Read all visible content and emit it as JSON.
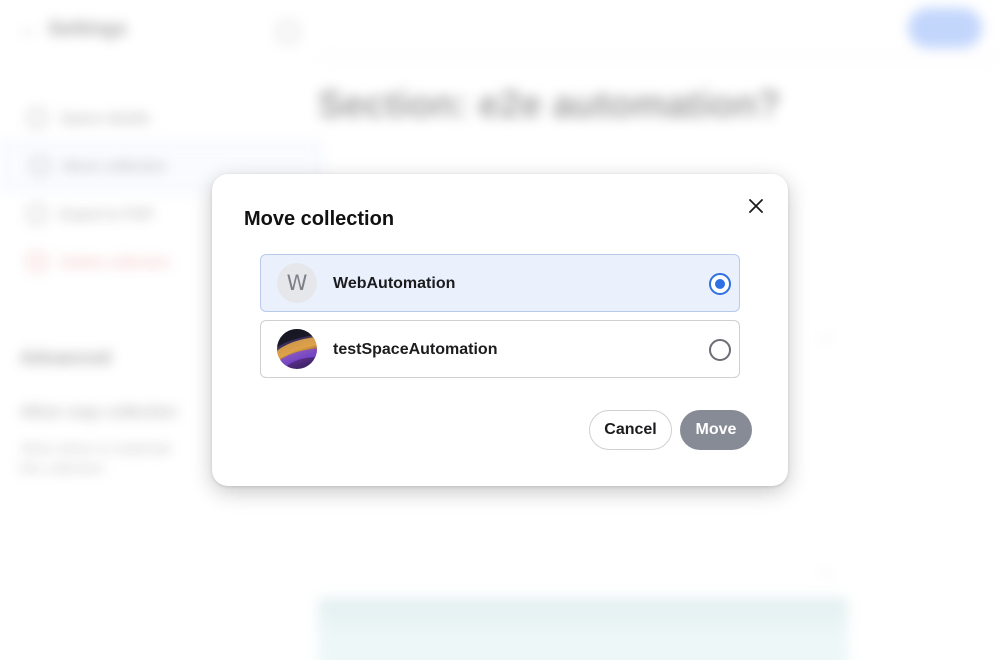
{
  "background": {
    "header_title": "Settings",
    "main_title": "Section: e2e automation?",
    "sidebar_items": [
      {
        "label": "Space details",
        "active": false,
        "danger": false
      },
      {
        "label": "Move collection",
        "active": true,
        "danger": false
      },
      {
        "label": "Export to PDF",
        "active": false,
        "danger": false
      },
      {
        "label": "Delete collection",
        "active": false,
        "danger": true
      }
    ],
    "section_title": "Advanced",
    "sub_title": "Allow copy collection",
    "sub_text": "Allow others to duplicate this collection"
  },
  "modal": {
    "title": "Move collection",
    "close_icon": "close-icon",
    "options": [
      {
        "label": "WebAutomation",
        "avatar_letter": "W",
        "avatar_type": "letter",
        "selected": true
      },
      {
        "label": "testSpaceAutomation",
        "avatar_letter": "",
        "avatar_type": "image",
        "selected": false
      }
    ],
    "cancel_label": "Cancel",
    "move_label": "Move"
  },
  "colors": {
    "accent": "#2f6fe4",
    "selected_bg": "#eaf1fd",
    "move_button_disabled": "#868b96"
  }
}
